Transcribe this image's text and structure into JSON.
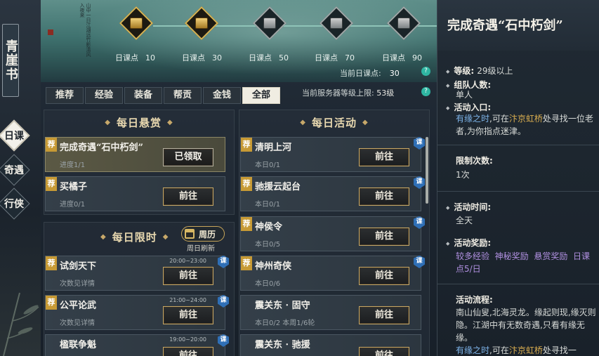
{
  "left_nav": {
    "book_title": "青崖书",
    "tabs": [
      {
        "label": "日课",
        "active": true
      },
      {
        "label": "奇遇",
        "active": false
      },
      {
        "label": "行侠",
        "active": false
      }
    ]
  },
  "banner": {
    "milestones": [
      {
        "label": "日课点",
        "points": "10",
        "claimed": true
      },
      {
        "label": "日课点",
        "points": "30",
        "claimed": true
      },
      {
        "label": "日课点",
        "points": "50",
        "claimed": false
      },
      {
        "label": "日课点",
        "points": "70",
        "claimed": false
      },
      {
        "label": "日课点",
        "points": "90",
        "claimed": false
      }
    ],
    "current_label": "当前日课点:",
    "current_value": "30",
    "help_icon": "question-icon"
  },
  "tabs": [
    {
      "label": "推荐",
      "active": false
    },
    {
      "label": "经验",
      "active": false
    },
    {
      "label": "装备",
      "active": false
    },
    {
      "label": "帮贡",
      "active": false
    },
    {
      "label": "金钱",
      "active": false
    },
    {
      "label": "全部",
      "active": true
    }
  ],
  "server_level": {
    "label": "当前服务器等级上限:",
    "value": "53级"
  },
  "daily_reward": {
    "title": "每日悬赏",
    "items": [
      {
        "tag": "荐",
        "name": "完成奇遇“石中朽剑”",
        "progress": "进度1/1",
        "button": "已领取"
      },
      {
        "tag": "荐",
        "name": "买橘子",
        "progress": "进度0/1",
        "button": "前往"
      }
    ]
  },
  "daily_limited": {
    "title": "每日限时",
    "calendar_label": "周历",
    "refresh_note": "周日刷新",
    "items": [
      {
        "tag": "荐",
        "name": "试剑天下",
        "progress": "次数见详情",
        "time": "20:00~23:00",
        "button": "前往",
        "badge": "课"
      },
      {
        "tag": "荐",
        "name": "公平论武",
        "progress": "次数见详情",
        "time": "21:00~24:00",
        "button": "前往",
        "badge": "课"
      },
      {
        "tag": "",
        "name": "楹联争魁",
        "progress": "",
        "time": "19:00~20:00",
        "button": "前往",
        "badge": "课"
      }
    ]
  },
  "daily_activity": {
    "title": "每日活动",
    "items": [
      {
        "tag": "荐",
        "name": "清明上河",
        "progress": "本日0/1",
        "button": "前往",
        "badge": "课"
      },
      {
        "tag": "荐",
        "name": "驰援云起台",
        "progress": "本日0/1",
        "button": "前往",
        "badge": "课"
      },
      {
        "tag": "荐",
        "name": "神侯令",
        "progress": "本日0/5",
        "button": "前往",
        "badge": "课"
      },
      {
        "tag": "荐",
        "name": "神州奇侠",
        "progress": "本日0/6",
        "button": "前往",
        "badge": "课"
      },
      {
        "tag": "",
        "name": "震关东 · 固守",
        "progress": "本日0/2  本周1/6轮",
        "button": "前往",
        "badge": ""
      },
      {
        "tag": "",
        "name": "震关东 · 驰援",
        "progress": "",
        "button": "前往",
        "badge": ""
      }
    ]
  },
  "detail": {
    "title": "完成奇遇“石中朽剑”",
    "level_label": "等级:",
    "level_value": "29级以上",
    "team_label": "组队人数:",
    "team_value": "单人",
    "entry_label": "活动入口:",
    "entry_link1": "有缘之时",
    "entry_text1": ",可在",
    "entry_link2": "汴京虹桥",
    "entry_text2": "处寻找一位老者,为你指点迷津。",
    "limit_label": "限制次数:",
    "limit_value": "1次",
    "time_label": "活动时间:",
    "time_value": "全天",
    "reward_label": "活动奖励:",
    "rewards": [
      "较多经验",
      "神秘奖励",
      "悬赏奖励",
      "日课点5/日"
    ],
    "flow_label": "活动流程:",
    "flow_text": "南山仙叟,北海灵龙。缘起则现,缘灭则隐。江湖中有无数奇遇,只看有缘无缘。",
    "flow_link1": "有缘之时",
    "flow_text1": ",可在",
    "flow_link2": "汴京虹桥",
    "flow_text2": "处寻找一"
  },
  "colors": {
    "accent_gold": "#c6a766",
    "link_blue": "#7db3e8",
    "link_gold": "#d9ad4f",
    "reward_purple": "#b090e0",
    "tag_gold": "#c79a35",
    "badge_blue": "#2f6fb6"
  }
}
